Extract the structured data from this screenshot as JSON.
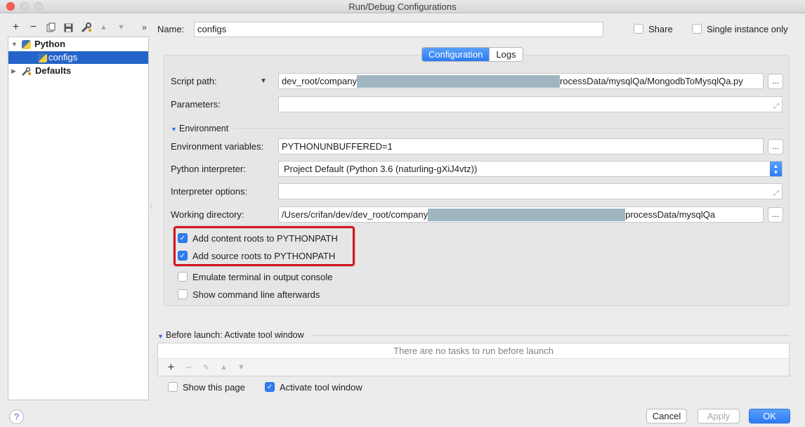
{
  "window": {
    "title": "Run/Debug Configurations"
  },
  "toolbar": {
    "icons": [
      "add-icon",
      "remove-icon",
      "copy-icon",
      "save-icon",
      "wrench-icon",
      "move-up-icon",
      "move-down-icon",
      "more-icon"
    ],
    "add": "+",
    "remove": "−",
    "up": "▲",
    "down": "▼",
    "more": "»"
  },
  "tree": {
    "python": "Python",
    "configs": "configs",
    "defaults": "Defaults"
  },
  "form": {
    "name_label": "Name:",
    "name_value": "configs",
    "share_label": "Share",
    "single_instance_label": "Single instance only",
    "tabs": [
      "Configuration",
      "Logs"
    ],
    "script_path_label": "Script path:",
    "script_path_prefix": "dev_root/company",
    "script_path_suffix": "rocessData/mysqlQa/MongodbToMysqlQa.py",
    "parameters_label": "Parameters:",
    "environment_section": "Environment",
    "env_vars_label": "Environment variables:",
    "env_vars_value": "PYTHONUNBUFFERED=1",
    "interpreter_label": "Python interpreter:",
    "interpreter_value": "Project Default (Python 3.6 (naturling-gXiJ4vtz))",
    "interpreter_options_label": "Interpreter options:",
    "working_dir_label": "Working directory:",
    "working_dir_prefix": "/Users/crifan/dev/dev_root/company",
    "working_dir_suffix": "processData/mysqlQa",
    "dots": "...",
    "add_content_roots": "Add content roots to PYTHONPATH",
    "add_source_roots": "Add source roots to PYTHONPATH",
    "emulate_terminal": "Emulate terminal in output console",
    "show_command_line": "Show command line afterwards"
  },
  "before_launch": {
    "title": "Before launch: Activate tool window",
    "empty": "There are no tasks to run before launch",
    "show_this_page": "Show this page",
    "activate_tool_window": "Activate tool window"
  },
  "buttons": {
    "cancel": "Cancel",
    "apply": "Apply",
    "ok": "OK",
    "help": "?"
  },
  "colors": {
    "accent": "#2c7cf4",
    "selection": "#2463c9",
    "highlight_box": "#d6131b",
    "redaction": "#9fb6c1"
  }
}
